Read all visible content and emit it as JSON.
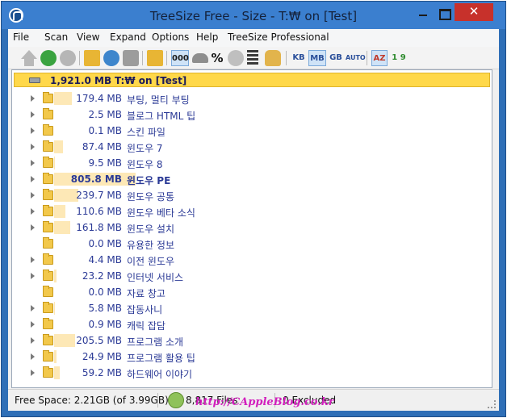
{
  "window": {
    "title": "TreeSize Free - Size - T:₩  on  [Test]",
    "close_glyph": "✕"
  },
  "menu": [
    "File",
    "Scan",
    "View",
    "Expand",
    "Options",
    "Help",
    "TreeSize Professional"
  ],
  "toolbar": {
    "units": [
      "KB",
      "MB",
      "GB",
      "AUTO"
    ],
    "sort_az": "AZ",
    "sort_19": "1 9",
    "percent": "%",
    "zeros": "000",
    "active_unit": "MB",
    "icons": [
      "up-icon",
      "back-icon",
      "forward-icon",
      "open-folder-icon",
      "refresh-icon",
      "print-icon",
      "export-icon",
      "size-view-icon",
      "allocated-icon",
      "percent-icon",
      "disk-icon",
      "files-icon",
      "hand-icon"
    ]
  },
  "root": {
    "size": "1,921.0 MB",
    "name": "T:₩  on  [Test]"
  },
  "rows": [
    {
      "size": "179.4 MB",
      "name": "부팅, 멀티 부팅",
      "fraction": 0.093,
      "expandable": true,
      "bold": false
    },
    {
      "size": "2.5 MB",
      "name": "블로그 HTML 팁",
      "fraction": 0.001,
      "expandable": true,
      "bold": false
    },
    {
      "size": "0.1 MB",
      "name": "스킨 파일",
      "fraction": 0.0,
      "expandable": true,
      "bold": false
    },
    {
      "size": "87.4 MB",
      "name": "윈도우 7",
      "fraction": 0.045,
      "expandable": true,
      "bold": false
    },
    {
      "size": "9.5 MB",
      "name": "윈도우 8",
      "fraction": 0.005,
      "expandable": true,
      "bold": false
    },
    {
      "size": "805.8 MB",
      "name": "윈도우 PE",
      "fraction": 0.419,
      "expandable": true,
      "bold": true
    },
    {
      "size": "239.7 MB",
      "name": "윈도우 공통",
      "fraction": 0.125,
      "expandable": true,
      "bold": false
    },
    {
      "size": "110.6 MB",
      "name": "윈도우 베타 소식",
      "fraction": 0.058,
      "expandable": true,
      "bold": false
    },
    {
      "size": "161.8 MB",
      "name": "윈도우 설치",
      "fraction": 0.084,
      "expandable": true,
      "bold": false
    },
    {
      "size": "0.0 MB",
      "name": "유용한 정보",
      "fraction": 0.0,
      "expandable": false,
      "bold": false
    },
    {
      "size": "4.4 MB",
      "name": "이전 윈도우",
      "fraction": 0.002,
      "expandable": true,
      "bold": false
    },
    {
      "size": "23.2 MB",
      "name": "인터넷 서비스",
      "fraction": 0.012,
      "expandable": true,
      "bold": false
    },
    {
      "size": "0.0 MB",
      "name": "자료 창고",
      "fraction": 0.0,
      "expandable": false,
      "bold": false
    },
    {
      "size": "5.8 MB",
      "name": "잡동사니",
      "fraction": 0.003,
      "expandable": true,
      "bold": false
    },
    {
      "size": "0.9 MB",
      "name": "캐릭 잡담",
      "fraction": 0.0,
      "expandable": true,
      "bold": false
    },
    {
      "size": "205.5 MB",
      "name": "프로그램 소개",
      "fraction": 0.107,
      "expandable": true,
      "bold": false
    },
    {
      "size": "24.9 MB",
      "name": "프로그램 활용 팁",
      "fraction": 0.013,
      "expandable": true,
      "bold": false
    },
    {
      "size": "59.2 MB",
      "name": "하드웨어 이야기",
      "fraction": 0.031,
      "expandable": true,
      "bold": false
    }
  ],
  "status": {
    "free_space": "Free Space: 2.21GB  (of 3.99GB)",
    "files": "8,817  Files",
    "excluded": "0 Excluded",
    "watermark": "http://CAppleBlog.co.kr"
  },
  "colors": {
    "title_bar": "#3b7fcf",
    "close_button": "#c7312b",
    "root_highlight": "#ffd84a",
    "size_bar": "#fde8b6",
    "tree_text": "#2b3a96",
    "watermark": "#d21fbd"
  }
}
